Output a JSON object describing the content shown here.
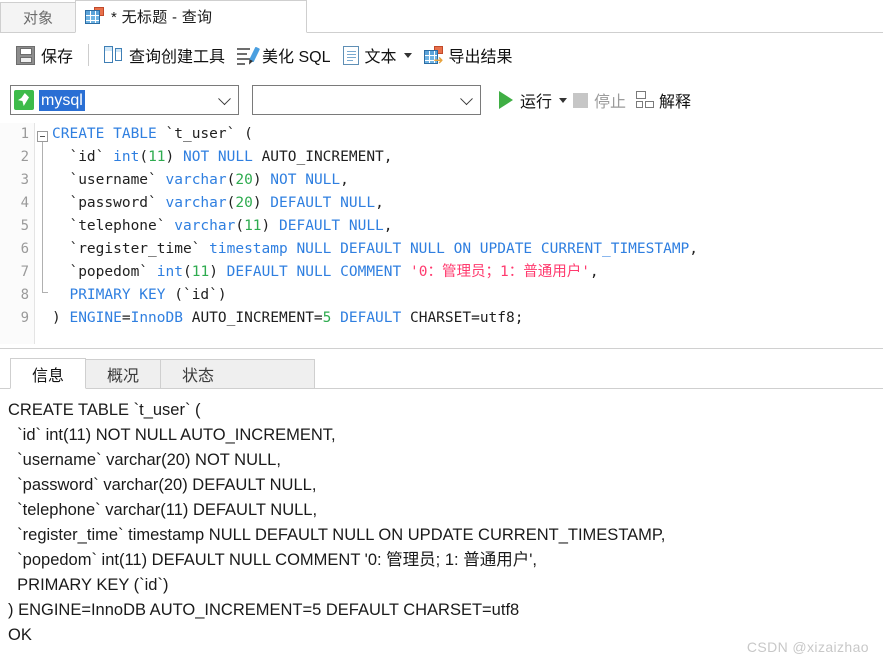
{
  "window": {
    "object_tab_label": "对象",
    "query_tab_label": "* 无标题 - 查询"
  },
  "toolbar": {
    "save_label": "保存",
    "query_builder_label": "查询创建工具",
    "beautify_label": "美化 SQL",
    "text_label": "文本",
    "export_label": "导出结果"
  },
  "connection": {
    "database_value": "mysql",
    "schema_value": "",
    "run_label": "运行",
    "stop_label": "停止",
    "explain_label": "解释"
  },
  "editor": {
    "line_numbers": [
      "1",
      "2",
      "3",
      "4",
      "5",
      "6",
      "7",
      "8",
      "9"
    ],
    "lines": [
      "CREATE TABLE `t_user` (",
      "  `id` int(11) NOT NULL AUTO_INCREMENT,",
      "  `username` varchar(20) NOT NULL,",
      "  `password` varchar(20) DEFAULT NULL,",
      "  `telephone` varchar(11) DEFAULT NULL,",
      "  `register_time` timestamp NULL DEFAULT NULL ON UPDATE CURRENT_TIMESTAMP,",
      "  `popedom` int(11) DEFAULT NULL COMMENT '0：管理员；1：普通用户',",
      "  PRIMARY KEY (`id`)",
      ") ENGINE=InnoDB AUTO_INCREMENT=5 DEFAULT CHARSET=utf8;"
    ]
  },
  "results": {
    "tabs": [
      {
        "label": "信息",
        "active": true
      },
      {
        "label": "概况",
        "active": false
      },
      {
        "label": "状态",
        "active": false
      }
    ],
    "output_text": "CREATE TABLE `t_user` (\n  `id` int(11) NOT NULL AUTO_INCREMENT,\n  `username` varchar(20) NOT NULL,\n  `password` varchar(20) DEFAULT NULL,\n  `telephone` varchar(11) DEFAULT NULL,\n  `register_time` timestamp NULL DEFAULT NULL ON UPDATE CURRENT_TIMESTAMP,\n  `popedom` int(11) DEFAULT NULL COMMENT '0: 管理员; 1: 普通用户',\n  PRIMARY KEY (`id`)\n) ENGINE=InnoDB AUTO_INCREMENT=5 DEFAULT CHARSET=utf8\nOK"
  },
  "watermark": {
    "text": "CSDN @xizaizhao"
  },
  "colors": {
    "keyword": "#2f7fe0",
    "number": "#2eab4f",
    "string": "#ff3a6e",
    "run_green": "#3fae44",
    "selection_blue": "#2a6fd4"
  }
}
